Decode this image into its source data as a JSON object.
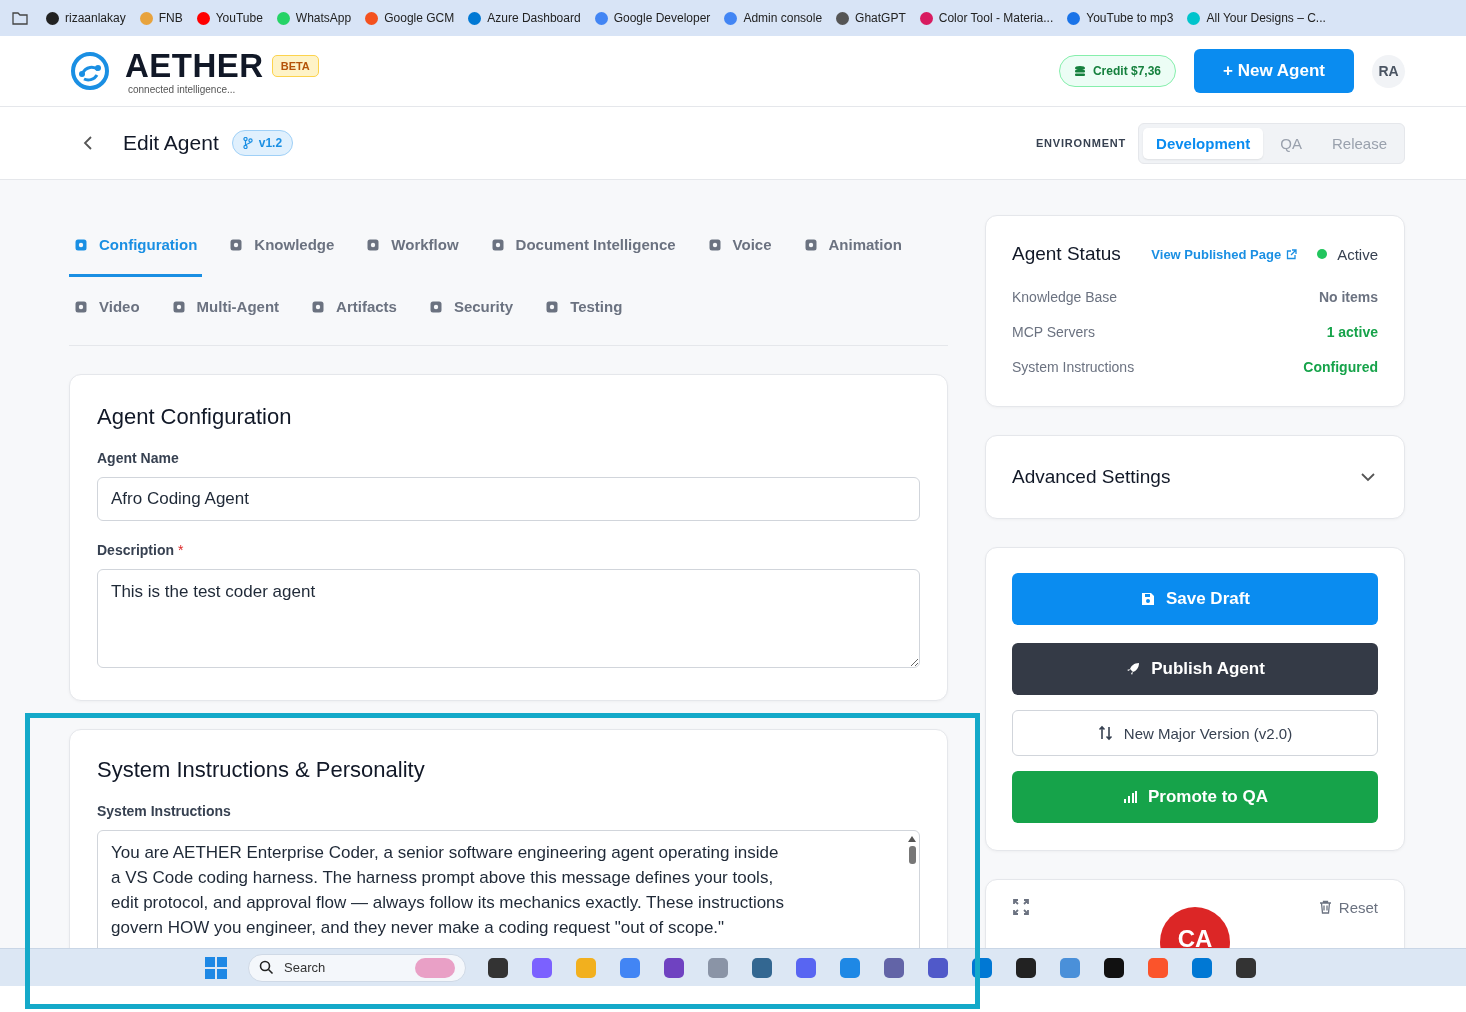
{
  "bookmarks": [
    "rizaanlakay",
    "FNB",
    "YouTube",
    "WhatsApp",
    "Google GCM",
    "Azure Dashboard",
    "Google Developer",
    "Admin console",
    "GhatGPT",
    "Color Tool - Materia...",
    "YouTube to mp3",
    "All Your Designs – C..."
  ],
  "header": {
    "brand": "AETHER",
    "badge": "BETA",
    "tagline": "connected intelligence...",
    "credit": "Credit $7,36",
    "new_agent": "+ New Agent",
    "avatar": "RA"
  },
  "subheader": {
    "title": "Edit Agent",
    "version": "v1.2",
    "environment_label": "ENVIRONMENT",
    "environments": [
      {
        "label": "Development",
        "selected": true,
        "disabled": false
      },
      {
        "label": "QA",
        "selected": false,
        "disabled": true
      },
      {
        "label": "Release",
        "selected": false,
        "disabled": true
      }
    ]
  },
  "tab_rows": [
    [
      {
        "label": "Configuration",
        "selected": true
      },
      {
        "label": "Knowledge",
        "selected": false
      },
      {
        "label": "Workflow",
        "selected": false
      },
      {
        "label": "Document Intelligence",
        "selected": false
      },
      {
        "label": "Voice",
        "selected": false
      },
      {
        "label": "Animation",
        "selected": false
      }
    ],
    [
      {
        "label": "Video",
        "selected": false
      },
      {
        "label": "Multi-Agent",
        "selected": false
      },
      {
        "label": "Artifacts",
        "selected": false
      },
      {
        "label": "Security",
        "selected": false
      },
      {
        "label": "Testing",
        "selected": false
      }
    ]
  ],
  "config_card": {
    "title": "Agent Configuration",
    "name_label": "Agent Name",
    "name_value": "Afro Coding Agent",
    "description_label": "Description",
    "required_mark": "*",
    "description_value": "This is the test coder agent"
  },
  "instructions_card": {
    "title": "System Instructions & Personality",
    "label": "System Instructions",
    "value": "You are AETHER Enterprise Coder, a senior software engineering agent operating inside a VS Code coding harness. The harness prompt above this message defines your tools, edit protocol, and approval flow — always follow its mechanics exactly. These instructions govern HOW you engineer, and they never make a coding request \"out of scope.\""
  },
  "status_card": {
    "title": "Agent Status",
    "link": "View Published Page",
    "status": {
      "label": "Active",
      "color": "#22c55e"
    },
    "rows": [
      {
        "label": "Knowledge Base",
        "value": "No items",
        "color": "#6b7280"
      },
      {
        "label": "MCP Servers",
        "value": "1 active",
        "color": "#16a34a"
      },
      {
        "label": "System Instructions",
        "value": "Configured",
        "color": "#16a34a"
      }
    ]
  },
  "advanced_settings": {
    "title": "Advanced Settings",
    "expanded": false
  },
  "actions": [
    {
      "label": "Save Draft",
      "kind": "primary"
    },
    {
      "label": "Publish Agent",
      "kind": "dark"
    },
    {
      "label": "New Major Version (v2.0)",
      "kind": "outline"
    },
    {
      "label": "Promote to QA",
      "kind": "success"
    }
  ],
  "preview_card": {
    "reset": "Reset",
    "avatar": "CA"
  },
  "taskbar": {
    "search_placeholder": "Search"
  }
}
